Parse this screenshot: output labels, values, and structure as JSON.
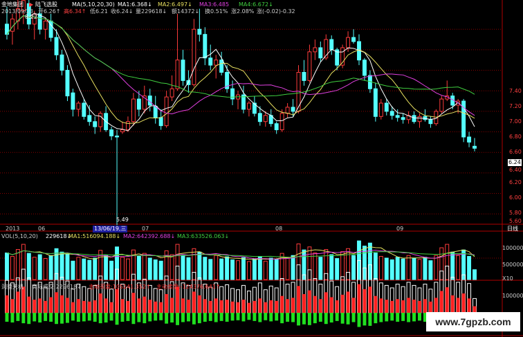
{
  "header": {
    "brand": "金地集团",
    "stock_name": "陆飞选股",
    "ma_label": "MA(5,10,20,30)",
    "ma1": "MA1:6.368↓",
    "ma2": "MA2:6.497↓",
    "ma3": "MA3:6.485",
    "ma4": "MA4:6.672↓",
    "date": "2013/09/23",
    "open": "开6.26↑",
    "high": "高6.34↑",
    "low": "低6.21",
    "close": "收6.24↓",
    "volume": "量229618↓",
    "amount": "额14372↓",
    "turnover": "换0.51%",
    "change_pct": "涨2.08%",
    "change": "涨(-0.02)-0.32"
  },
  "annotations": {
    "high_label": "8.22",
    "low_label": "5.49",
    "last_price": "6.24"
  },
  "price_axis": [
    "7.40",
    "7.20",
    "7.00",
    "6.80",
    "6.60",
    "6.40",
    "6.20",
    "6.00",
    "5.80",
    "5.60"
  ],
  "date_axis": {
    "year": "2013",
    "months": [
      "06",
      "07",
      "08",
      "09"
    ],
    "cursor": "13/06/19,三",
    "period": "日线"
  },
  "volume_panel": {
    "header": "VOL(5,10,20)",
    "value": "229618↓",
    "ma1": "MA1:516094.188↓",
    "ma2": "MA2:642392.688↓",
    "ma3": "MA3:633526.063↓",
    "axis": [
      "1000000",
      "500000",
      "X10"
    ]
  },
  "flow_panel": {
    "title": "洞察天机",
    "actual_label": "实际成交:229618↓",
    "buy": "主动买盘:105241.352↑",
    "sell": "主动卖盘:-124376.641↑",
    "axis": [
      "1000000"
    ]
  },
  "watermark": "www.7gpzb.com",
  "colors": {
    "up": "#ff3c3c",
    "down": "#54ffff",
    "ma5": "#ffffff",
    "ma10": "#e8e060",
    "ma20": "#e040e0",
    "ma30": "#40d040",
    "grid": "#8a0000",
    "buy": "#ff2020",
    "sell": "#20e020"
  },
  "chart_data": {
    "type": "candlestick",
    "title": "陆飞选股",
    "y_axis": {
      "min": 5.5,
      "max": 7.5
    },
    "candles": [
      {
        "o": 7.45,
        "h": 7.62,
        "l": 7.3,
        "c": 7.35
      },
      {
        "o": 7.38,
        "h": 7.55,
        "l": 7.25,
        "c": 7.5
      },
      {
        "o": 7.48,
        "h": 7.7,
        "l": 7.4,
        "c": 7.6
      },
      {
        "o": 7.58,
        "h": 8.22,
        "l": 7.45,
        "c": 7.68
      },
      {
        "o": 7.65,
        "h": 7.72,
        "l": 7.4,
        "c": 7.45
      },
      {
        "o": 7.45,
        "h": 7.58,
        "l": 7.3,
        "c": 7.55
      },
      {
        "o": 7.55,
        "h": 7.62,
        "l": 7.35,
        "c": 7.4
      },
      {
        "o": 7.4,
        "h": 7.5,
        "l": 7.3,
        "c": 7.48
      },
      {
        "o": 7.48,
        "h": 7.55,
        "l": 7.28,
        "c": 7.32
      },
      {
        "o": 7.32,
        "h": 7.4,
        "l": 7.1,
        "c": 7.15
      },
      {
        "o": 7.15,
        "h": 7.2,
        "l": 6.95,
        "c": 7.0
      },
      {
        "o": 7.0,
        "h": 7.05,
        "l": 6.7,
        "c": 6.75
      },
      {
        "o": 6.78,
        "h": 6.82,
        "l": 6.55,
        "c": 6.62
      },
      {
        "o": 6.62,
        "h": 6.7,
        "l": 6.55,
        "c": 6.68
      },
      {
        "o": 6.68,
        "h": 6.72,
        "l": 6.52,
        "c": 6.55
      },
      {
        "o": 6.56,
        "h": 6.66,
        "l": 6.46,
        "c": 6.5
      },
      {
        "o": 6.5,
        "h": 6.55,
        "l": 6.38,
        "c": 6.45
      },
      {
        "o": 6.45,
        "h": 6.6,
        "l": 6.4,
        "c": 6.58
      },
      {
        "o": 6.58,
        "h": 6.65,
        "l": 6.4,
        "c": 6.42
      },
      {
        "o": 6.42,
        "h": 6.45,
        "l": 6.32,
        "c": 6.36
      },
      {
        "o": 6.36,
        "h": 6.42,
        "l": 5.49,
        "c": 6.35
      },
      {
        "o": 6.4,
        "h": 6.5,
        "l": 6.38,
        "c": 6.42
      },
      {
        "o": 6.42,
        "h": 6.55,
        "l": 6.4,
        "c": 6.5
      },
      {
        "o": 6.5,
        "h": 6.78,
        "l": 6.46,
        "c": 6.72
      },
      {
        "o": 6.72,
        "h": 6.8,
        "l": 6.55,
        "c": 6.62
      },
      {
        "o": 6.62,
        "h": 6.85,
        "l": 6.58,
        "c": 6.75
      },
      {
        "o": 6.75,
        "h": 6.82,
        "l": 6.6,
        "c": 6.66
      },
      {
        "o": 6.65,
        "h": 6.75,
        "l": 6.48,
        "c": 6.54
      },
      {
        "o": 6.54,
        "h": 6.62,
        "l": 6.42,
        "c": 6.46
      },
      {
        "o": 6.46,
        "h": 6.8,
        "l": 6.44,
        "c": 6.74
      },
      {
        "o": 6.74,
        "h": 6.95,
        "l": 6.7,
        "c": 6.82
      },
      {
        "o": 6.82,
        "h": 7.55,
        "l": 6.8,
        "c": 7.1
      },
      {
        "o": 7.1,
        "h": 7.2,
        "l": 6.85,
        "c": 6.9
      },
      {
        "o": 6.9,
        "h": 7.0,
        "l": 6.78,
        "c": 6.86
      },
      {
        "o": 6.86,
        "h": 7.5,
        "l": 6.84,
        "c": 7.4
      },
      {
        "o": 7.4,
        "h": 7.6,
        "l": 7.28,
        "c": 7.35
      },
      {
        "o": 7.35,
        "h": 7.42,
        "l": 7.05,
        "c": 7.12
      },
      {
        "o": 7.12,
        "h": 7.25,
        "l": 7.0,
        "c": 7.05
      },
      {
        "o": 7.05,
        "h": 7.15,
        "l": 6.92,
        "c": 7.1
      },
      {
        "o": 7.1,
        "h": 7.18,
        "l": 6.95,
        "c": 6.98
      },
      {
        "o": 6.98,
        "h": 7.05,
        "l": 6.78,
        "c": 6.82
      },
      {
        "o": 6.82,
        "h": 6.9,
        "l": 6.66,
        "c": 6.72
      },
      {
        "o": 6.72,
        "h": 6.8,
        "l": 6.62,
        "c": 6.76
      },
      {
        "o": 6.76,
        "h": 6.85,
        "l": 6.58,
        "c": 6.62
      },
      {
        "o": 6.62,
        "h": 6.7,
        "l": 6.55,
        "c": 6.68
      },
      {
        "o": 6.68,
        "h": 6.75,
        "l": 6.55,
        "c": 6.58
      },
      {
        "o": 6.58,
        "h": 6.65,
        "l": 6.46,
        "c": 6.5
      },
      {
        "o": 6.5,
        "h": 6.6,
        "l": 6.45,
        "c": 6.56
      },
      {
        "o": 6.56,
        "h": 6.62,
        "l": 6.45,
        "c": 6.48
      },
      {
        "o": 6.48,
        "h": 6.5,
        "l": 6.38,
        "c": 6.42
      },
      {
        "o": 6.42,
        "h": 6.62,
        "l": 6.4,
        "c": 6.58
      },
      {
        "o": 6.58,
        "h": 6.68,
        "l": 6.54,
        "c": 6.64
      },
      {
        "o": 6.64,
        "h": 6.72,
        "l": 6.55,
        "c": 6.6
      },
      {
        "o": 6.6,
        "h": 7.05,
        "l": 6.58,
        "c": 6.98
      },
      {
        "o": 6.98,
        "h": 7.1,
        "l": 6.85,
        "c": 6.9
      },
      {
        "o": 6.9,
        "h": 7.25,
        "l": 6.88,
        "c": 7.18
      },
      {
        "o": 7.18,
        "h": 7.3,
        "l": 7.1,
        "c": 7.22
      },
      {
        "o": 7.22,
        "h": 7.28,
        "l": 7.08,
        "c": 7.12
      },
      {
        "o": 7.12,
        "h": 7.35,
        "l": 7.1,
        "c": 7.3
      },
      {
        "o": 7.3,
        "h": 7.34,
        "l": 7.15,
        "c": 7.2
      },
      {
        "o": 7.2,
        "h": 7.22,
        "l": 7.0,
        "c": 7.05
      },
      {
        "o": 7.05,
        "h": 7.25,
        "l": 7.02,
        "c": 7.22
      },
      {
        "o": 7.22,
        "h": 7.38,
        "l": 7.18,
        "c": 7.32
      },
      {
        "o": 7.32,
        "h": 7.4,
        "l": 7.26,
        "c": 7.28
      },
      {
        "o": 7.28,
        "h": 7.35,
        "l": 7.05,
        "c": 7.1
      },
      {
        "o": 7.1,
        "h": 7.12,
        "l": 6.9,
        "c": 6.95
      },
      {
        "o": 6.95,
        "h": 7.0,
        "l": 6.78,
        "c": 6.82
      },
      {
        "o": 6.82,
        "h": 6.88,
        "l": 6.5,
        "c": 6.55
      },
      {
        "o": 6.55,
        "h": 6.72,
        "l": 6.52,
        "c": 6.68
      },
      {
        "o": 6.68,
        "h": 6.72,
        "l": 6.56,
        "c": 6.6
      },
      {
        "o": 6.6,
        "h": 6.65,
        "l": 6.52,
        "c": 6.56
      },
      {
        "o": 6.56,
        "h": 6.62,
        "l": 6.5,
        "c": 6.54
      },
      {
        "o": 6.54,
        "h": 6.58,
        "l": 6.48,
        "c": 6.52
      },
      {
        "o": 6.52,
        "h": 6.6,
        "l": 6.48,
        "c": 6.56
      },
      {
        "o": 6.56,
        "h": 6.6,
        "l": 6.48,
        "c": 6.5
      },
      {
        "o": 6.5,
        "h": 6.58,
        "l": 6.44,
        "c": 6.55
      },
      {
        "o": 6.55,
        "h": 6.62,
        "l": 6.5,
        "c": 6.52
      },
      {
        "o": 6.52,
        "h": 6.55,
        "l": 6.44,
        "c": 6.48
      },
      {
        "o": 6.48,
        "h": 6.62,
        "l": 6.46,
        "c": 6.6
      },
      {
        "o": 6.6,
        "h": 6.75,
        "l": 6.58,
        "c": 6.72
      },
      {
        "o": 6.72,
        "h": 6.9,
        "l": 6.7,
        "c": 6.75
      },
      {
        "o": 6.75,
        "h": 6.78,
        "l": 6.62,
        "c": 6.66
      },
      {
        "o": 6.66,
        "h": 6.72,
        "l": 6.58,
        "c": 6.7
      },
      {
        "o": 6.7,
        "h": 6.72,
        "l": 6.3,
        "c": 6.35
      },
      {
        "o": 6.35,
        "h": 6.4,
        "l": 6.25,
        "c": 6.3
      },
      {
        "o": 6.26,
        "h": 6.34,
        "l": 6.21,
        "c": 6.24
      }
    ],
    "volume": [
      620,
      540,
      700,
      820,
      610,
      520,
      580,
      490,
      560,
      720,
      640,
      590,
      430,
      520,
      480,
      450,
      500,
      680,
      560,
      430,
      760,
      520,
      480,
      690,
      540,
      610,
      500,
      460,
      430,
      670,
      580,
      820,
      560,
      510,
      720,
      640,
      520,
      470,
      560,
      480,
      530,
      460,
      440,
      510,
      420,
      480,
      540,
      430,
      500,
      470,
      610,
      520,
      560,
      830,
      690,
      760,
      620,
      520,
      700,
      580,
      490,
      650,
      720,
      560,
      900,
      780,
      850,
      620,
      540,
      500,
      460,
      520,
      480,
      560,
      500,
      470,
      520,
      440,
      560,
      740,
      820,
      640,
      560,
      690,
      540,
      230
    ],
    "flow_buy": [
      280,
      220,
      340,
      420,
      260,
      210,
      230,
      190,
      250,
      330,
      280,
      240,
      170,
      220,
      190,
      180,
      200,
      310,
      230,
      170,
      380,
      220,
      190,
      320,
      230,
      260,
      210,
      180,
      170,
      300,
      240,
      420,
      230,
      210,
      340,
      280,
      220,
      190,
      230,
      200,
      210,
      180,
      170,
      210,
      160,
      190,
      230,
      170,
      200,
      190,
      270,
      220,
      240,
      430,
      300,
      360,
      270,
      220,
      330,
      250,
      200,
      290,
      340,
      240,
      460,
      380,
      420,
      270,
      230,
      210,
      190,
      220,
      200,
      240,
      210,
      190,
      220,
      180,
      240,
      350,
      410,
      280,
      240,
      310,
      230,
      105
    ],
    "flow_sell": [
      240,
      260,
      220,
      280,
      300,
      230,
      260,
      220,
      240,
      300,
      290,
      270,
      210,
      240,
      230,
      210,
      240,
      280,
      260,
      210,
      320,
      240,
      220,
      300,
      250,
      280,
      230,
      210,
      200,
      290,
      260,
      330,
      250,
      230,
      310,
      280,
      240,
      220,
      250,
      220,
      240,
      210,
      200,
      230,
      190,
      220,
      250,
      200,
      230,
      210,
      280,
      240,
      250,
      340,
      310,
      330,
      280,
      240,
      300,
      260,
      220,
      290,
      310,
      250,
      380,
      340,
      350,
      280,
      250,
      230,
      210,
      240,
      220,
      250,
      230,
      210,
      240,
      200,
      250,
      320,
      340,
      290,
      250,
      300,
      240,
      124
    ]
  }
}
